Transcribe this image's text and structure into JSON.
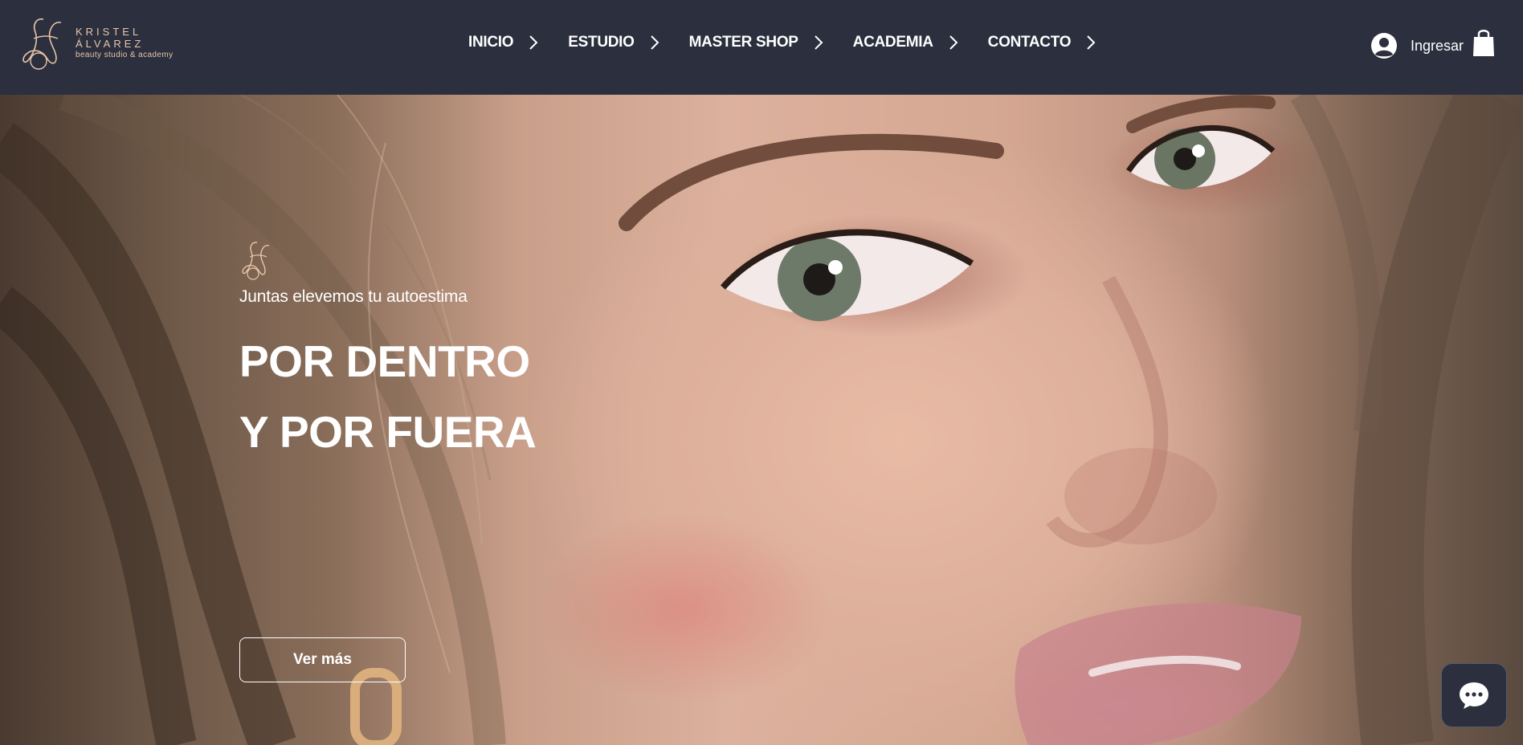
{
  "brand": {
    "line1": "KRISTEL",
    "line2": "ÁLVAREZ",
    "line3": "beauty studio & academy",
    "accent_color": "#e8c6a8"
  },
  "nav": {
    "items": [
      {
        "label": "INICIO",
        "icon": "chevron-right-icon"
      },
      {
        "label": "ESTUDIO",
        "icon": "chevron-right-icon"
      },
      {
        "label": "MASTER SHOP",
        "icon": "chevron-right-icon"
      },
      {
        "label": "ACADEMIA",
        "icon": "chevron-right-icon"
      },
      {
        "label": "CONTACTO",
        "icon": "chevron-right-icon"
      }
    ]
  },
  "account": {
    "login_label": "Ingresar",
    "user_icon": "user-circle-icon",
    "cart_icon": "shopping-bag-icon"
  },
  "hero": {
    "tagline": "Juntas elevemos tu autoestima",
    "title_line1": "POR DENTRO",
    "title_line2": "Y POR FUERA",
    "cta_label": "Ver más"
  },
  "chat": {
    "icon": "chat-bubble-icon"
  },
  "colors": {
    "header_bg": "#2b2f3e",
    "text_on_dark": "#ffffff"
  }
}
